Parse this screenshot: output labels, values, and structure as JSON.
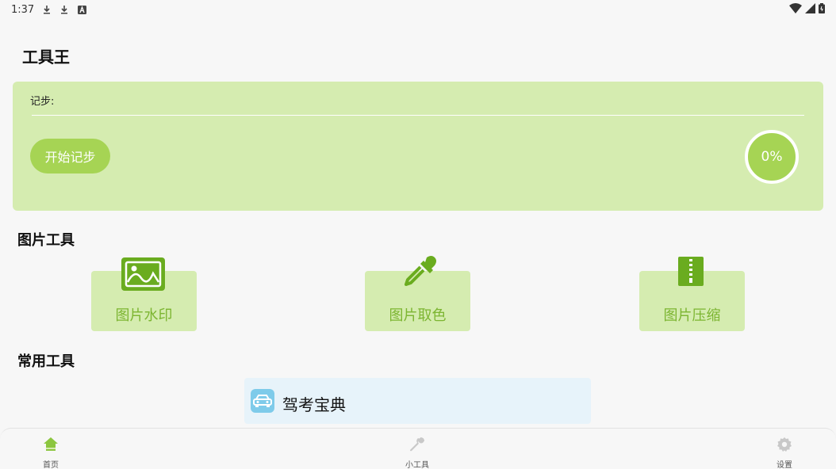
{
  "status_bar": {
    "time": "1:37",
    "left_icons": [
      "download-icon",
      "download-icon",
      "a-badge-icon"
    ],
    "right_icons": [
      "wifi-icon",
      "signal-icon",
      "battery-icon"
    ]
  },
  "app": {
    "title": "工具王"
  },
  "step_card": {
    "label": "记步:",
    "start_button": "开始记步",
    "progress": "0%",
    "progress_value": 0
  },
  "image_tools": {
    "title": "图片工具",
    "items": [
      {
        "label": "图片水印",
        "icon": "image-icon"
      },
      {
        "label": "图片取色",
        "icon": "eyedropper-icon"
      },
      {
        "label": "图片压缩",
        "icon": "zip-file-icon"
      }
    ]
  },
  "common_tools": {
    "title": "常用工具",
    "items": [
      {
        "label": "驾考宝典",
        "icon": "car-icon"
      }
    ]
  },
  "bottom_nav": {
    "items": [
      {
        "label": "首页",
        "icon": "home-icon",
        "active": true
      },
      {
        "label": "小工具",
        "icon": "wrench-icon",
        "active": false
      },
      {
        "label": "设置",
        "icon": "gear-icon",
        "active": false
      }
    ]
  },
  "colors": {
    "accent_green": "#a6d454",
    "card_green": "#d5ecb0",
    "label_green": "#7cb531",
    "icon_green": "#6aac1f",
    "blue_light": "#e7f3fa",
    "blue_icon": "#7ecbea"
  }
}
